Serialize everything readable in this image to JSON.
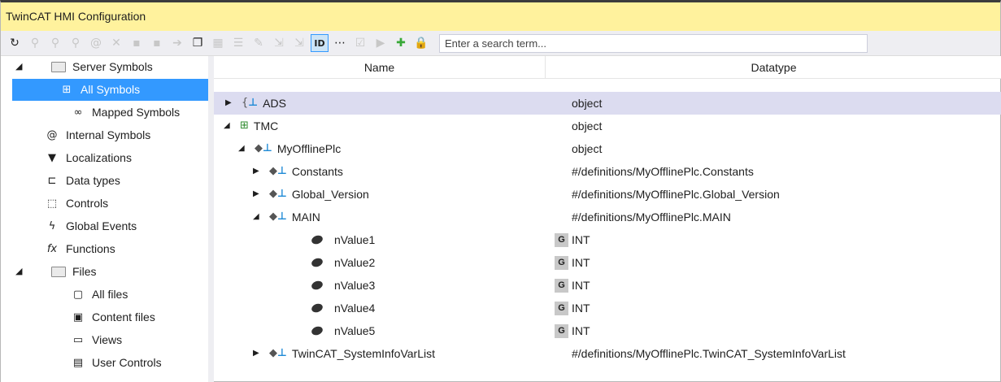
{
  "window": {
    "title": "TwinCAT HMI Configuration"
  },
  "toolbar": {
    "icons": [
      "refresh-icon",
      "map-icon",
      "map-all-icon",
      "unmap-icon",
      "at-icon",
      "delete-icon",
      "tag-icon",
      "tag2-icon",
      "arrow-icon",
      "copy-icon",
      "table-icon",
      "list-icon",
      "edit-icon",
      "move-icon",
      "move2-icon",
      "id-icon",
      "more-icon",
      "checkbox-icon",
      "play-icon",
      "add-icon",
      "lock-icon"
    ],
    "search_placeholder": "Enter a search term..."
  },
  "sidebar": {
    "items": [
      {
        "label": "Server Symbols",
        "icon": "folder-icon"
      },
      {
        "label": "All Symbols",
        "icon": "all-symbols-icon"
      },
      {
        "label": "Mapped Symbols",
        "icon": "mapped-symbols-icon"
      },
      {
        "label": "Internal Symbols",
        "icon": "at-icon"
      },
      {
        "label": "Localizations",
        "icon": "localization-icon"
      },
      {
        "label": "Data types",
        "icon": "datatypes-icon"
      },
      {
        "label": "Controls",
        "icon": "controls-icon"
      },
      {
        "label": "Global Events",
        "icon": "lightning-icon"
      },
      {
        "label": "Functions",
        "icon": "function-icon"
      },
      {
        "label": "Files",
        "icon": "folder-icon"
      },
      {
        "label": "All files",
        "icon": "all-files-icon"
      },
      {
        "label": "Content files",
        "icon": "content-files-icon"
      },
      {
        "label": "Views",
        "icon": "views-icon"
      },
      {
        "label": "User Controls",
        "icon": "user-controls-icon"
      }
    ]
  },
  "table": {
    "columns": [
      "Name",
      "Datatype"
    ],
    "rows": [
      {
        "name": "ADS",
        "type": "object",
        "badge": ""
      },
      {
        "name": "TMC",
        "type": "object",
        "badge": ""
      },
      {
        "name": "MyOfflinePlc",
        "type": "object",
        "badge": ""
      },
      {
        "name": "Constants",
        "type": "#/definitions/MyOfflinePlc.Constants",
        "badge": ""
      },
      {
        "name": "Global_Version",
        "type": "#/definitions/MyOfflinePlc.Global_Version",
        "badge": ""
      },
      {
        "name": "MAIN",
        "type": "#/definitions/MyOfflinePlc.MAIN",
        "badge": ""
      },
      {
        "name": "nValue1",
        "type": "INT",
        "badge": "G"
      },
      {
        "name": "nValue2",
        "type": "INT",
        "badge": "G"
      },
      {
        "name": "nValue3",
        "type": "INT",
        "badge": "G"
      },
      {
        "name": "nValue4",
        "type": "INT",
        "badge": "G"
      },
      {
        "name": "nValue5",
        "type": "INT",
        "badge": "G"
      },
      {
        "name": "TwinCAT_SystemInfoVarList",
        "type": "#/definitions/MyOfflinePlc.TwinCAT_SystemInfoVarList",
        "badge": ""
      }
    ]
  },
  "colors": {
    "title_bg": "#fff29d",
    "selection": "#3399ff",
    "row_highlight": "#dcdcf0"
  }
}
